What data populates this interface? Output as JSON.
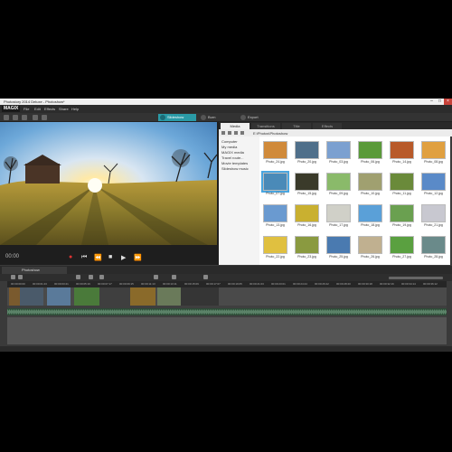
{
  "window": {
    "title": "Photostory 2014 Deluxe - Photoshow*"
  },
  "menu": {
    "logo": "MAGIX",
    "items": [
      {
        "label": "File"
      },
      {
        "label": "Edit"
      },
      {
        "label": "Effects"
      },
      {
        "label": "Share"
      },
      {
        "label": "Help"
      }
    ]
  },
  "modes": {
    "slideshow": "Slideshow",
    "burn": "Burn",
    "export": "Export"
  },
  "player": {
    "timecode": "00:00"
  },
  "media": {
    "tabs": [
      {
        "label": "Media"
      },
      {
        "label": "Transitions"
      },
      {
        "label": "Title"
      },
      {
        "label": "Effects"
      }
    ],
    "path": "E:\\Photos\\Photoshow",
    "tree": [
      {
        "label": "Computer"
      },
      {
        "label": "My media"
      },
      {
        "label": "MAGIX media"
      },
      {
        "label": "Travel route..."
      },
      {
        "label": "Movie templates"
      },
      {
        "label": "Slideshow music"
      }
    ],
    "thumbs": [
      {
        "label": "Photo_24.jpg"
      },
      {
        "label": "Photo_20.jpg"
      },
      {
        "label": "Photo_03.jpg"
      },
      {
        "label": "Photo_06.jpg"
      },
      {
        "label": "Photo_14.jpg"
      },
      {
        "label": "Photo_08.jpg"
      },
      {
        "label": "Photo_07.jpg"
      },
      {
        "label": "Photo_15.jpg"
      },
      {
        "label": "Photo_09.jpg"
      },
      {
        "label": "Photo_10.jpg"
      },
      {
        "label": "Photo_11.jpg"
      },
      {
        "label": "Photo_12.jpg"
      },
      {
        "label": "Photo_13.jpg"
      },
      {
        "label": "Photo_16.jpg"
      },
      {
        "label": "Photo_17.jpg"
      },
      {
        "label": "Photo_18.jpg"
      },
      {
        "label": "Photo_19.jpg"
      },
      {
        "label": "Photo_21.jpg"
      },
      {
        "label": "Photo_22.jpg"
      },
      {
        "label": "Photo_23.jpg"
      },
      {
        "label": "Photo_25.jpg"
      },
      {
        "label": "Photo_26.jpg"
      },
      {
        "label": "Photo_27.jpg"
      },
      {
        "label": "Photo_28.jpg"
      }
    ]
  },
  "timeline": {
    "tab": "Photoshow",
    "ticks": [
      "00:00:00:00",
      "00:00:01:23",
      "00:00:03:21",
      "00:00:05:19",
      "00:00:07:17",
      "00:00:09:15",
      "00:00:11:13",
      "00:00:13:11",
      "00:00:15:09",
      "00:00:17:07",
      "00:00:19:05",
      "00:00:21:03",
      "00:00:23:01",
      "00:00:24:24",
      "00:00:26:22",
      "00:00:28:20",
      "00:00:30:18",
      "00:00:32:16",
      "00:00:34:14",
      "00:00:36:12"
    ]
  }
}
